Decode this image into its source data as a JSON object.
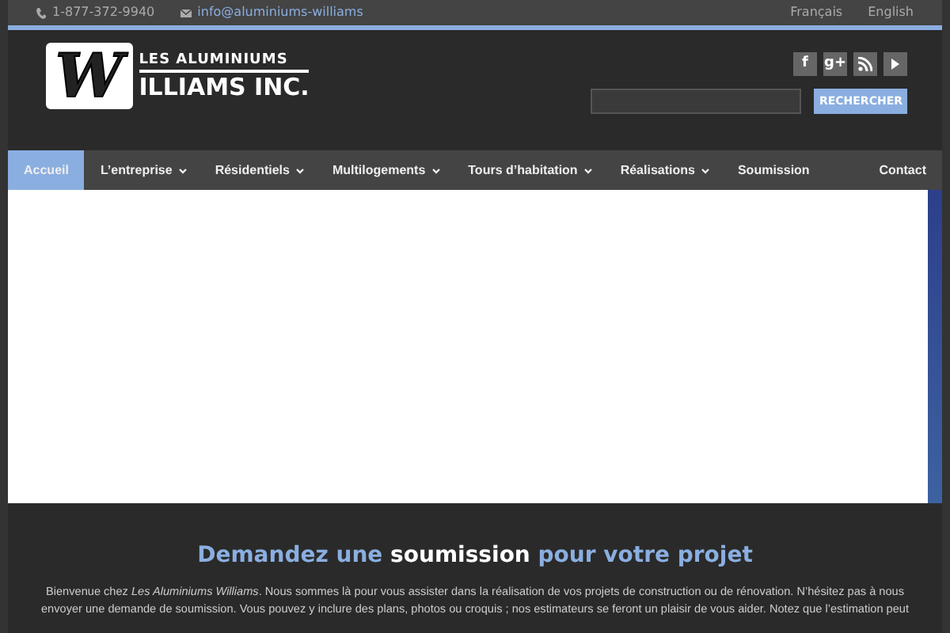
{
  "topbar": {
    "phone": "1-877-372-9940",
    "email": "info@aluminiums-williams",
    "languages": [
      "Français",
      "English"
    ]
  },
  "logo": {
    "letter": "W",
    "line1": "LES ALUMINIUMS",
    "line2": "ILLIAMS INC."
  },
  "social": [
    {
      "kind": "facebook",
      "label": "f"
    },
    {
      "kind": "gplus",
      "label": "g+"
    },
    {
      "kind": "rss"
    },
    {
      "kind": "youtube"
    }
  ],
  "search": {
    "button": "RECHERCHER"
  },
  "nav": [
    {
      "label": "Accueil",
      "selected": true,
      "dropdown": false
    },
    {
      "label": "L’entreprise",
      "selected": false,
      "dropdown": true
    },
    {
      "label": "Résidentiels",
      "selected": false,
      "dropdown": true
    },
    {
      "label": "Multilogements",
      "selected": false,
      "dropdown": true
    },
    {
      "label": "Tours d’habitation",
      "selected": false,
      "dropdown": true
    },
    {
      "label": "Réalisations",
      "selected": false,
      "dropdown": true
    },
    {
      "label": "Soumission",
      "selected": false,
      "dropdown": false
    },
    {
      "label": "Contact",
      "selected": false,
      "dropdown": false
    }
  ],
  "heading": [
    {
      "text": "Demandez une ",
      "highlight": false
    },
    {
      "text": "soumission",
      "highlight": true
    },
    {
      "text": " pour votre projet",
      "highlight": false
    }
  ],
  "intro": "Bienvenue chez *Les Aluminiums Williams*. Nous sommes là pour vous assister dans la réalisation de vos projets de construction ou de rénovation. N’hésitez pas à nous envoyer une demande de soumission. Vous pouvez y inclure des plans, photos ou croquis ; nos estimateurs se feront un plaisir de vous aider. Notez que l’estimation peut"
}
